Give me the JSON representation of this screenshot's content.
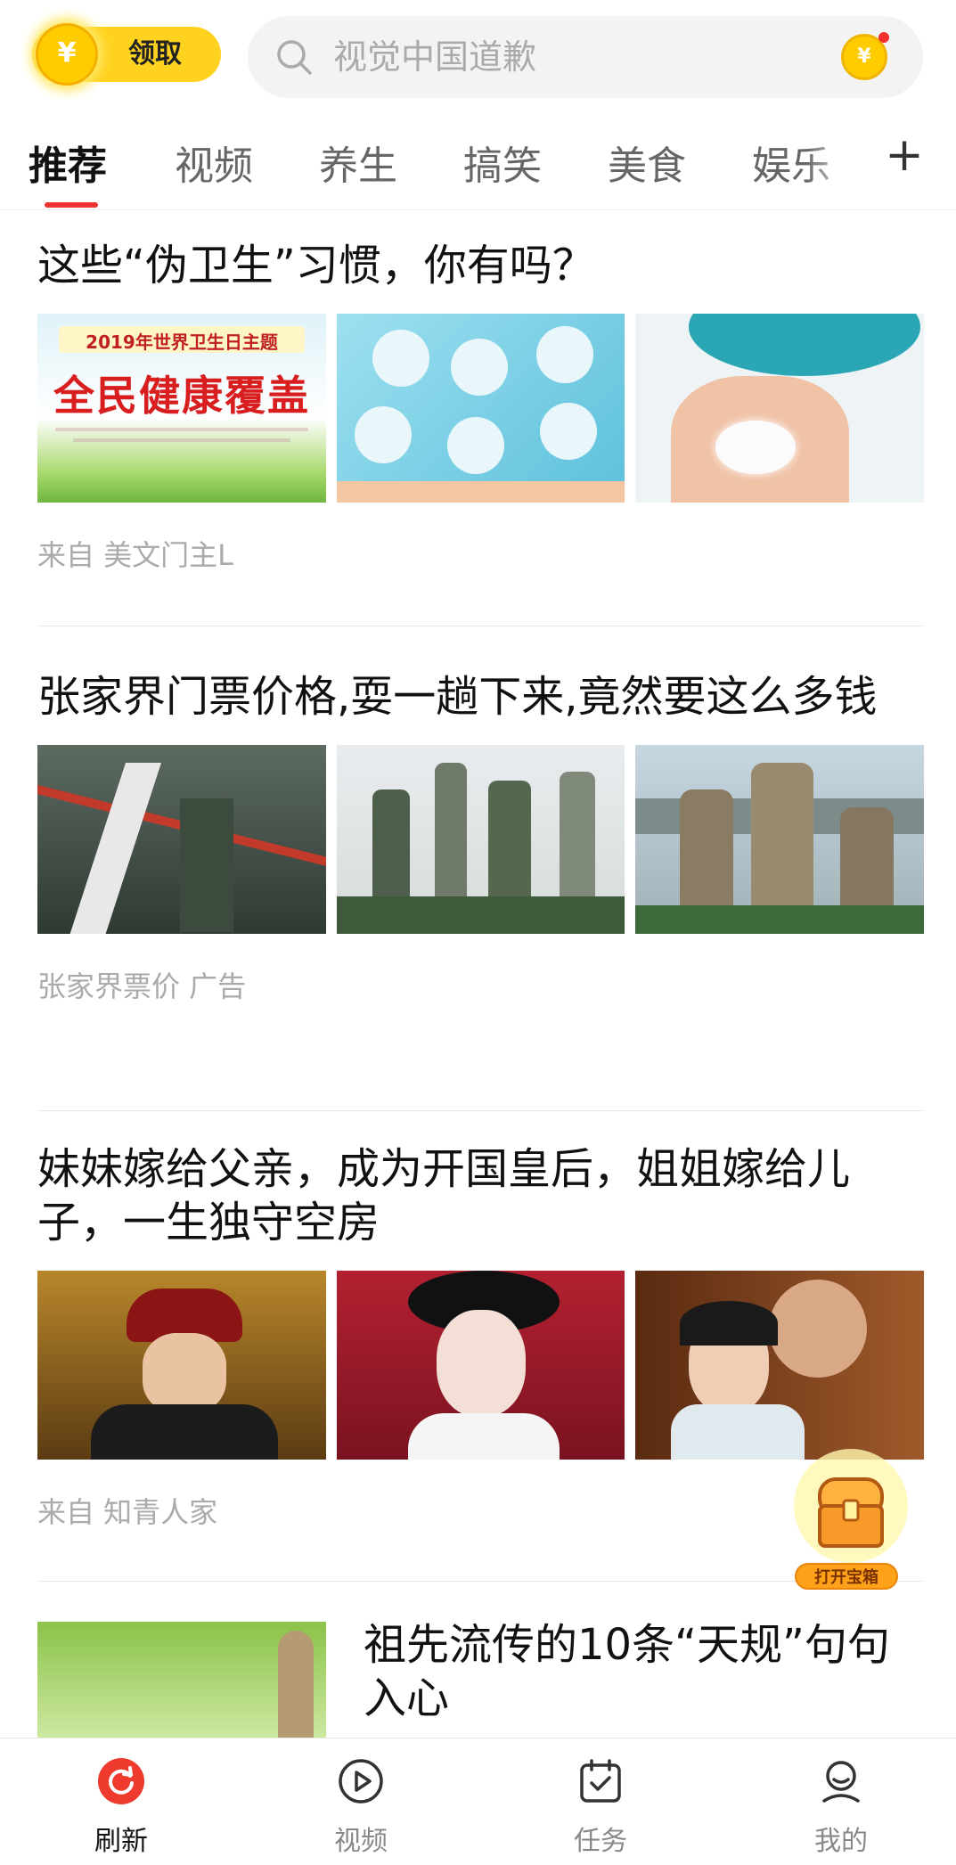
{
  "header": {
    "claim_label": "领取",
    "coin_symbol": "¥",
    "search_placeholder": "视觉中国道歉"
  },
  "tabs": [
    {
      "label": "推荐",
      "active": true
    },
    {
      "label": "视频",
      "active": false
    },
    {
      "label": "养生",
      "active": false
    },
    {
      "label": "搞笑",
      "active": false
    },
    {
      "label": "美食",
      "active": false
    },
    {
      "label": "娱乐",
      "active": false
    }
  ],
  "tab_add": "+",
  "feed": [
    {
      "title": "这些“伪卫生”习惯，你有吗？",
      "source": "来自 美文门主L",
      "thumb1_banner_line1": "2019年世界卫生日主题",
      "thumb1_banner_line2": "全民健康覆盖"
    },
    {
      "title": "张家界门票价格,耍一趟下来,竟然要这么多钱",
      "source": "张家界票价 广告"
    },
    {
      "title": "妹妹嫁给父亲，成为开国皇后，姐姐嫁给儿子，一生独守空房",
      "source": "来自 知青人家"
    },
    {
      "title": "祖先流传的10条“天规”句句入心"
    }
  ],
  "treasure": {
    "label": "打开宝箱"
  },
  "bottom_nav": [
    {
      "label": "刷新",
      "icon": "refresh-icon",
      "active": true
    },
    {
      "label": "视频",
      "icon": "play-icon",
      "active": false
    },
    {
      "label": "任务",
      "icon": "calendar-check-icon",
      "active": false
    },
    {
      "label": "我的",
      "icon": "user-icon",
      "active": false
    }
  ],
  "colors": {
    "accent": "#e33333",
    "gold": "#ffd21f"
  }
}
